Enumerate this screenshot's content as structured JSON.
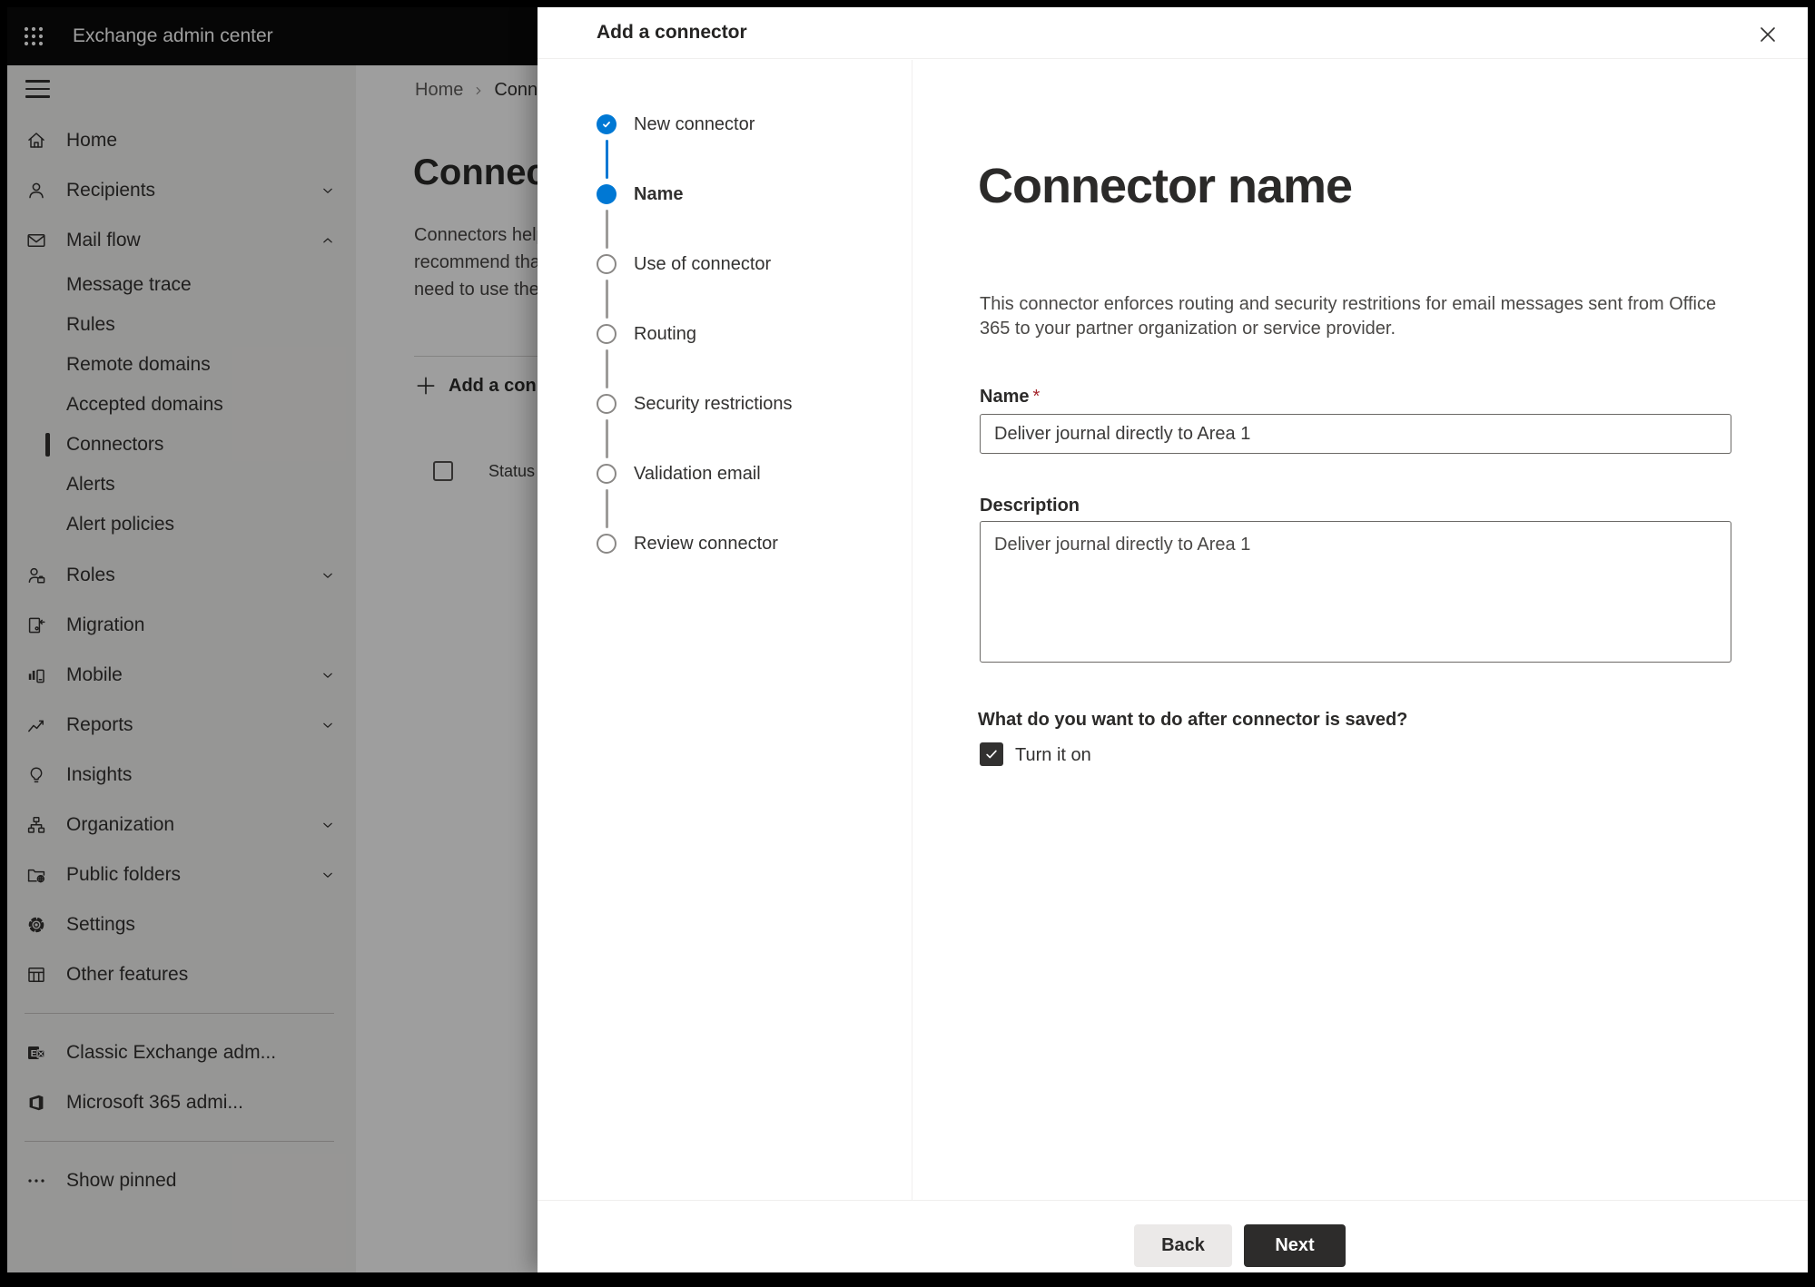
{
  "colors": {
    "accent": "#0078d4",
    "topbar_bg": "#0b0b0b",
    "sidebar_bg": "#f3f2f1",
    "text": "#323130",
    "required": "#a4262c"
  },
  "topbar": {
    "title": "Exchange admin center",
    "app_launcher_icon": "waffle-icon"
  },
  "sidebar": {
    "menu_icon": "hamburger-icon",
    "items": [
      {
        "label": "Home",
        "icon": "home-icon"
      },
      {
        "label": "Recipients",
        "icon": "person-icon",
        "chevron": "down"
      },
      {
        "label": "Mail flow",
        "icon": "mail-icon",
        "chevron": "up",
        "expanded": true
      },
      {
        "label": "Message trace",
        "type": "sub"
      },
      {
        "label": "Rules",
        "type": "sub"
      },
      {
        "label": "Remote domains",
        "type": "sub"
      },
      {
        "label": "Accepted domains",
        "type": "sub"
      },
      {
        "label": "Connectors",
        "type": "sub",
        "selected": true
      },
      {
        "label": "Alerts",
        "type": "sub"
      },
      {
        "label": "Alert policies",
        "type": "sub"
      },
      {
        "label": "Roles",
        "icon": "roles-icon",
        "chevron": "down"
      },
      {
        "label": "Migration",
        "icon": "migration-icon"
      },
      {
        "label": "Mobile",
        "icon": "mobile-icon",
        "chevron": "down"
      },
      {
        "label": "Reports",
        "icon": "reports-icon",
        "chevron": "down"
      },
      {
        "label": "Insights",
        "icon": "lightbulb-icon"
      },
      {
        "label": "Organization",
        "icon": "org-chart-icon",
        "chevron": "down"
      },
      {
        "label": "Public folders",
        "icon": "folder-globe-icon",
        "chevron": "down"
      },
      {
        "label": "Settings",
        "icon": "gear-icon"
      },
      {
        "label": "Other features",
        "icon": "grid-icon"
      },
      {
        "label": "Classic Exchange adm...",
        "icon": "exchange-logo-icon"
      },
      {
        "label": "Microsoft 365 admi...",
        "icon": "office-logo-icon"
      },
      {
        "label": "Show pinned",
        "icon": "ellipsis-icon"
      }
    ]
  },
  "main": {
    "breadcrumb": {
      "home": "Home",
      "current": "Conne"
    },
    "title": "Connec",
    "intro_lines": [
      "Connectors help",
      "recommend that",
      "need to use ther"
    ],
    "add_button": "Add a conn",
    "status_header": "Status"
  },
  "dialog": {
    "title": "Add a connector",
    "steps": [
      {
        "label": "New connector",
        "state": "done"
      },
      {
        "label": "Name",
        "state": "current"
      },
      {
        "label": "Use of connector",
        "state": "todo"
      },
      {
        "label": "Routing",
        "state": "todo"
      },
      {
        "label": "Security restrictions",
        "state": "todo"
      },
      {
        "label": "Validation email",
        "state": "todo"
      },
      {
        "label": "Review connector",
        "state": "todo"
      }
    ],
    "heading": "Connector name",
    "description": "This connector enforces routing and security restritions for email messages sent from Office 365 to your partner organization or service provider.",
    "name_label": "Name",
    "required_mark": "*",
    "name_value": "Deliver journal directly to Area 1",
    "description_label": "Description",
    "description_value": "Deliver journal directly to Area 1",
    "question": "What do you want to do after connector is saved?",
    "checkbox_label": "Turn it on",
    "checkbox_checked": true,
    "footer": {
      "back": "Back",
      "next": "Next"
    }
  }
}
